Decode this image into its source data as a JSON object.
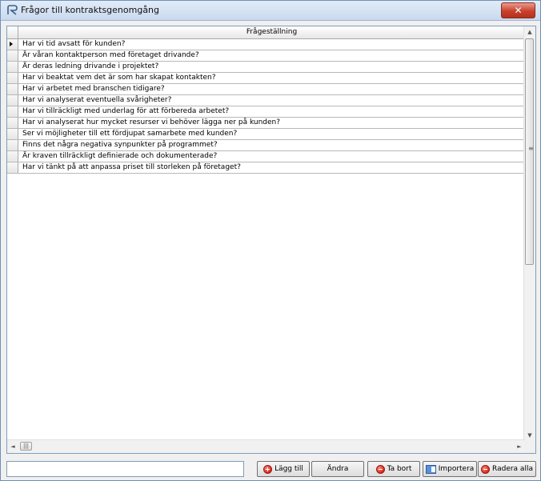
{
  "window": {
    "title": "Frågor till kontraktsgenomgång",
    "close_symbol": "✕"
  },
  "grid": {
    "column_header": "Frågeställning",
    "rows": [
      "Har vi tid avsatt för kunden?",
      "Är våran kontaktperson med företaget drivande?",
      "Är deras ledning drivande i projektet?",
      "Har vi beaktat vem det är som har skapat kontakten?",
      "Har vi arbetet med branschen tidigare?",
      "Har vi analyserat eventuella svårigheter?",
      "Har vi tillräckligt med underlag för att förbereda arbetet?",
      "Har vi analyserat hur mycket resurser vi behöver lägga ner på kunden?",
      "Ser vi möjligheter till ett fördjupat samarbete med kunden?",
      "Finns det några negativa synpunkter på programmet?",
      "Är kraven tillräckligt definierade och dokumenterade?",
      "Har vi tänkt på att anpassa priset till storleken på företaget?"
    ]
  },
  "scrollbars": {
    "up": "▲",
    "down": "▼",
    "left": "◄",
    "right": "►",
    "grip": "≡",
    "hgrip": "|||"
  },
  "input": {
    "value": ""
  },
  "buttons": {
    "add": "Lägg till",
    "edit": "Ändra",
    "remove": "Ta bort",
    "import": "Importera",
    "delete_all": "Radera alla"
  },
  "icons": {
    "title": "app-logo-icon",
    "add": "add-circle-icon",
    "remove": "remove-circle-icon",
    "import": "import-icon",
    "delete_all": "delete-circle-icon"
  }
}
